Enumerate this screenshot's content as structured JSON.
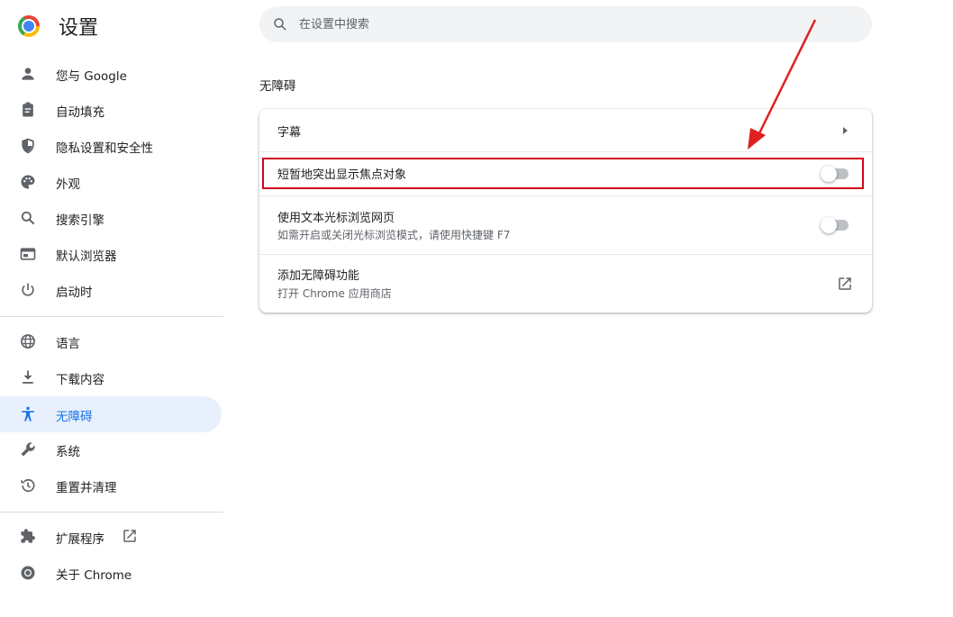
{
  "app": {
    "title": "设置"
  },
  "search": {
    "placeholder": "在设置中搜索",
    "value": ""
  },
  "sidebar": {
    "items": [
      {
        "label": "您与 Google",
        "icon": "person-icon"
      },
      {
        "label": "自动填充",
        "icon": "clipboard-icon"
      },
      {
        "label": "隐私设置和安全性",
        "icon": "shield-icon"
      },
      {
        "label": "外观",
        "icon": "palette-icon"
      },
      {
        "label": "搜索引擎",
        "icon": "search-icon"
      },
      {
        "label": "默认浏览器",
        "icon": "browser-icon"
      },
      {
        "label": "启动时",
        "icon": "power-icon"
      },
      {
        "label": "语言",
        "icon": "globe-icon"
      },
      {
        "label": "下载内容",
        "icon": "download-icon"
      },
      {
        "label": "无障碍",
        "icon": "accessibility-icon",
        "active": true
      },
      {
        "label": "系统",
        "icon": "wrench-icon"
      },
      {
        "label": "重置并清理",
        "icon": "history-icon"
      },
      {
        "label": "扩展程序",
        "icon": "puzzle-icon"
      },
      {
        "label": "关于 Chrome",
        "icon": "chrome-icon"
      }
    ]
  },
  "main": {
    "section_title": "无障碍",
    "rows": [
      {
        "title": "字幕",
        "control": "chevron-right"
      },
      {
        "title": "短暂地突出显示焦点对象",
        "control": "toggle",
        "checked": false
      },
      {
        "title": "使用文本光标浏览网页",
        "subtitle": "如需开启或关闭光标浏览模式，请使用快捷键 F7",
        "control": "toggle",
        "checked": false
      },
      {
        "title": "添加无障碍功能",
        "subtitle": "打开 Chrome 应用商店",
        "control": "open-in-new"
      }
    ]
  },
  "colors": {
    "accent": "#1a73e8",
    "active_bg": "#e8f0fe",
    "annotation": "#d0021b"
  }
}
